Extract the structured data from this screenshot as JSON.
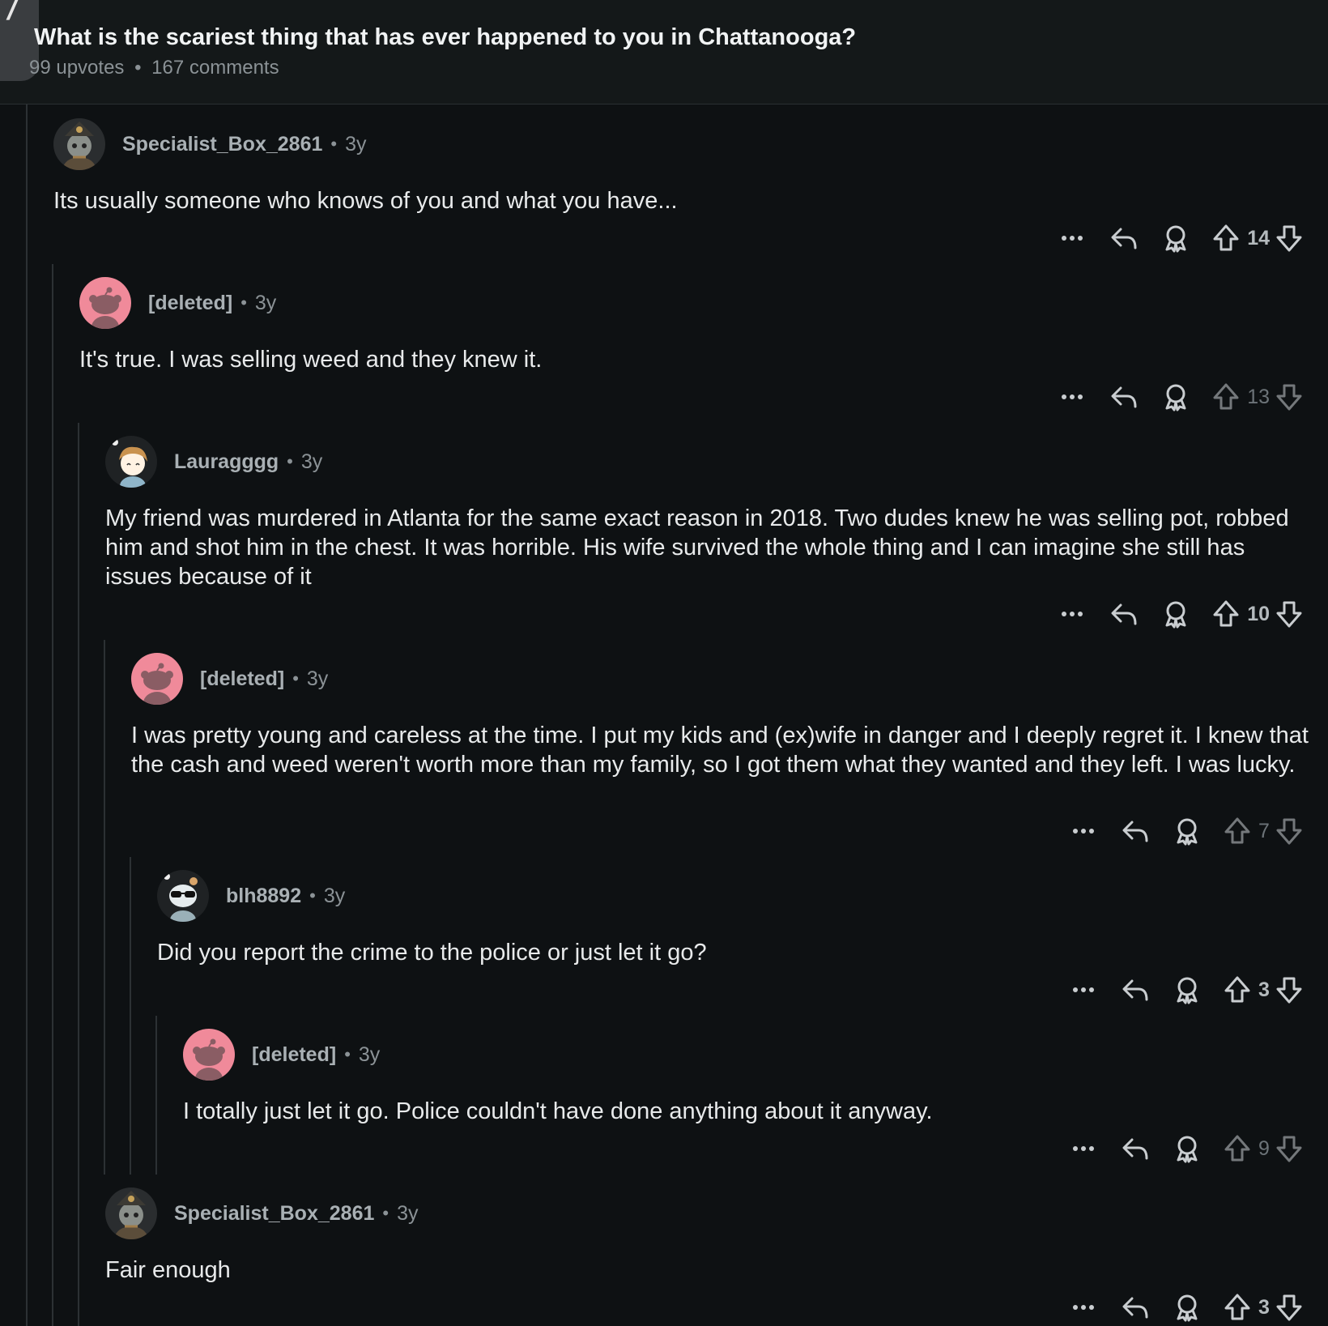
{
  "post": {
    "title": "What is the scariest thing that has ever happened to you in Chattanooga?",
    "upvotes": "99 upvotes",
    "separator": "•",
    "comments": "167 comments"
  },
  "colors": {
    "background": "#0e1113",
    "header": "#141819",
    "deleted_avatar": "#f08a9a",
    "text": "#e8eaeb",
    "meta": "#8b9296"
  },
  "comments": [
    {
      "author": "Specialist_Box_2861",
      "age": "3y",
      "avatar": "snoo-hat-avatar",
      "body": "Its usually someone who knows of you and what you have...",
      "score": "14",
      "dim": false
    },
    {
      "author": "[deleted]",
      "age": "3y",
      "avatar": "deleted-snoo-avatar",
      "body": "It's true. I was selling weed and they knew it.",
      "score": "13",
      "dim": true
    },
    {
      "author": "Lauragggg",
      "age": "3y",
      "avatar": "snoo-girl-avatar",
      "body": "My friend was murdered in Atlanta for the same exact reason in 2018. Two dudes knew he was selling pot, robbed him and shot him in the chest. It was horrible. His wife survived the whole thing and I can imagine she still has issues because of it",
      "score": "10",
      "dim": false
    },
    {
      "author": "[deleted]",
      "age": "3y",
      "avatar": "deleted-snoo-avatar",
      "body": "I was pretty young and careless at the time. I put my kids and (ex)wife in danger and I deeply regret it. I knew that the cash and weed weren't worth more than my family, so I got them what they wanted and they left. I was lucky.",
      "score": "7",
      "dim": true
    },
    {
      "author": "blh8892",
      "age": "3y",
      "avatar": "snoo-sunglasses-avatar",
      "body": "Did you report the crime to the police or just let it go?",
      "score": "3",
      "dim": false
    },
    {
      "author": "[deleted]",
      "age": "3y",
      "avatar": "deleted-snoo-avatar",
      "body": "I totally just let it go. Police couldn't have done anything about it anyway.",
      "score": "9",
      "dim": true
    },
    {
      "author": "Specialist_Box_2861",
      "age": "3y",
      "avatar": "snoo-hat-avatar",
      "body": "Fair enough",
      "score": "3",
      "dim": false
    }
  ],
  "icons": {
    "more": "more-options-icon",
    "reply": "reply-icon",
    "award": "award-icon",
    "upvote": "upvote-icon",
    "downvote": "downvote-icon"
  }
}
